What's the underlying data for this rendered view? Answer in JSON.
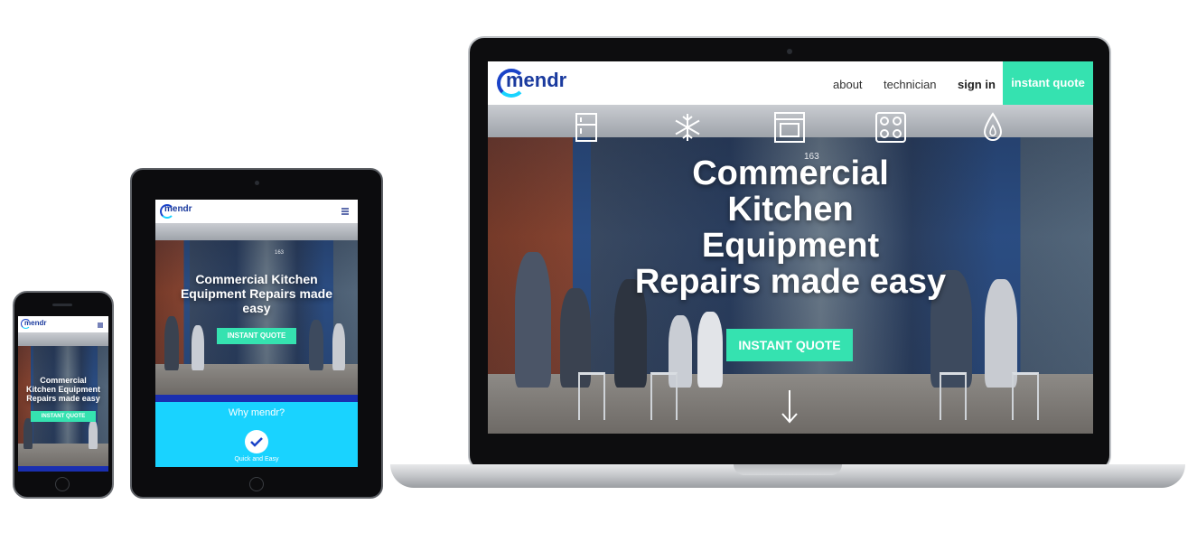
{
  "brand": "mendr",
  "laptop": {
    "nav": {
      "about": "about",
      "technician": "technician",
      "sign_in": "sign in",
      "instant_quote": "instant quote"
    },
    "hero": {
      "title_lines": [
        "Commercial",
        "Kitchen",
        "Equipment",
        "Repairs made easy"
      ],
      "button": "INSTANT QUOTE",
      "storefront_number": "163"
    },
    "icons": [
      "fridge-icon",
      "snowflake-icon",
      "oven-icon",
      "cooktop-icon",
      "water-drop-icon",
      "down-arrow-icon"
    ]
  },
  "tablet": {
    "hero": {
      "title_lines": [
        "Commercial Kitchen",
        "Equipment Repairs made",
        "easy"
      ],
      "button": "INSTANT QUOTE",
      "storefront_number": "163"
    },
    "why": {
      "heading": "Why mendr?",
      "item": "Quick and Easy"
    },
    "icons": [
      "hamburger-menu-icon",
      "checkmark-icon"
    ]
  },
  "phone": {
    "hero": {
      "title_lines": [
        "Commercial",
        "Kitchen Equipment",
        "Repairs made easy"
      ],
      "button": "INSTANT QUOTE"
    },
    "icons": [
      "hamburger-menu-icon"
    ]
  },
  "colors": {
    "accent": "#35e2b0",
    "brand_blue": "#1a43c8",
    "brand_cyan": "#19d3ff",
    "why_bg": "#19d3ff",
    "dark_blue_band": "#1a2fb0"
  }
}
